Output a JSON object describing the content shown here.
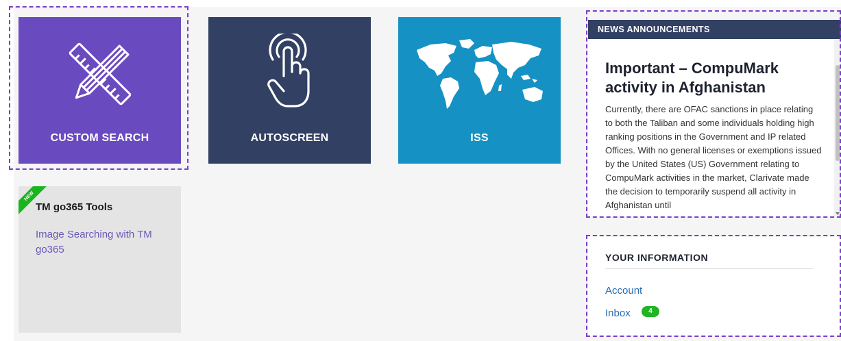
{
  "tiles": [
    {
      "label": "CUSTOM SEARCH",
      "icon": "ruler-pencil-icon",
      "color": "#6a4abf"
    },
    {
      "label": "AUTOSCREEN",
      "icon": "tap-finger-icon",
      "color": "#324063"
    },
    {
      "label": "ISS",
      "icon": "world-map-icon",
      "color": "#1592c3"
    }
  ],
  "tools_card": {
    "ribbon": "NEW",
    "title": "TM go365 Tools",
    "link": "Image Searching with TM go365"
  },
  "news": {
    "header": "NEWS ANNOUNCEMENTS",
    "title": "Important – CompuMark activity in Afghanistan",
    "body": "Currently, there are OFAC sanctions in place relating to both the Taliban and some individuals holding high ranking positions in the Government and IP related Offices. With no general licenses or exemptions issued by the United States (US) Government relating to CompuMark activities in the market, Clarivate made the decision to temporarily suspend all activity in Afghanistan until"
  },
  "your_information": {
    "title": "YOUR INFORMATION",
    "account_label": "Account",
    "inbox_label": "Inbox",
    "inbox_count": "4"
  },
  "colors": {
    "highlight_dash": "#7a3fc9",
    "badge_green": "#21b423",
    "link_blue": "#2a6bb0"
  }
}
